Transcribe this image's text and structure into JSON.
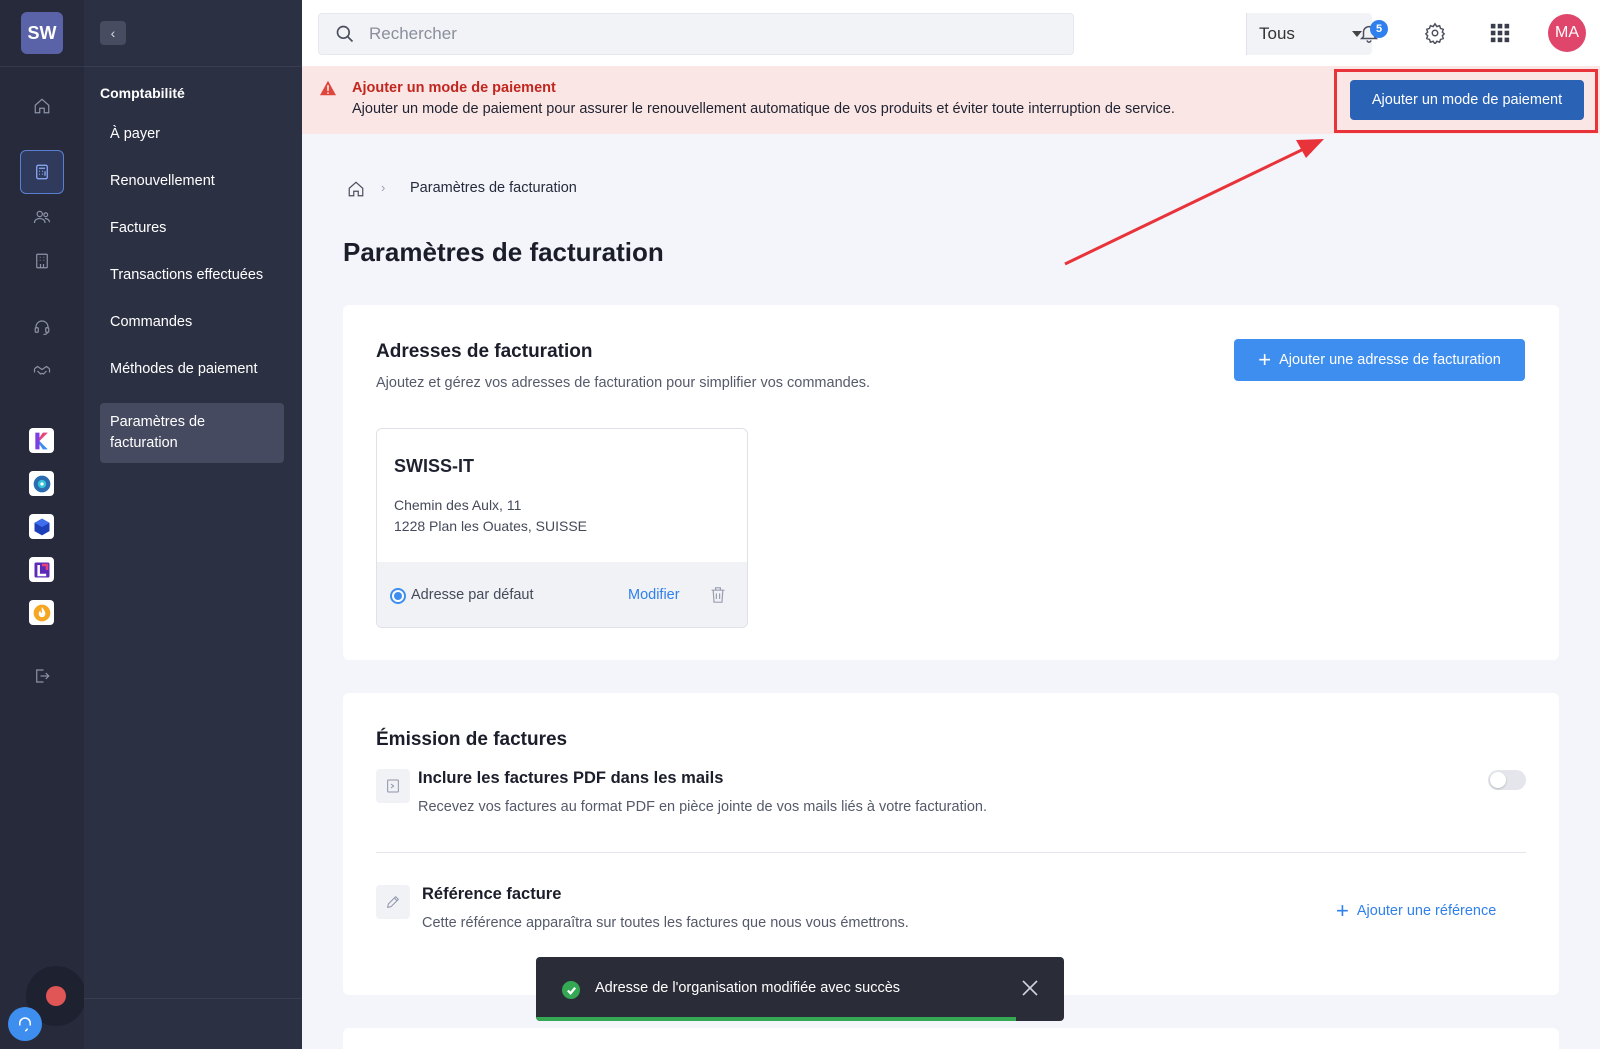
{
  "rail": {
    "logo": "SW",
    "icons": [
      "home-icon",
      "calculator-icon",
      "users-icon",
      "building-icon",
      "headset-icon",
      "handshake-icon"
    ],
    "apps": [
      "app-k-icon",
      "app-circle-icon",
      "app-cube-icon",
      "app-l-icon",
      "app-flame-icon"
    ],
    "logout": "logout-icon"
  },
  "sidebar": {
    "section": "Comptabilité",
    "items": [
      {
        "label": "À payer"
      },
      {
        "label": "Renouvellement"
      },
      {
        "label": "Factures"
      },
      {
        "label": "Transactions effectuées"
      },
      {
        "label": "Commandes"
      },
      {
        "label": "Méthodes de paiement"
      },
      {
        "label": "Paramètres de facturation",
        "active": true
      }
    ]
  },
  "topbar": {
    "search_placeholder": "Rechercher",
    "scope": "Tous",
    "notifications_count": "5",
    "avatar": "MA"
  },
  "alert": {
    "title": "Ajouter un mode de paiement",
    "message": "Ajouter un mode de paiement pour assurer le renouvellement automatique de vos produits et éviter toute interruption de service.",
    "button": "Ajouter un mode de paiement"
  },
  "breadcrumb": {
    "current": "Paramètres de facturation"
  },
  "page": {
    "title": "Paramètres de facturation"
  },
  "billing": {
    "title": "Adresses de facturation",
    "subtitle": "Ajoutez et gérez vos adresses de facturation pour simplifier vos commandes.",
    "add_button": "Ajouter une adresse de facturation",
    "address": {
      "name": "SWISS-IT",
      "line1": "Chemin des Aulx, 11",
      "line2": "1228 Plan les Ouates, SUISSE",
      "default_label": "Adresse par défaut",
      "modify": "Modifier"
    }
  },
  "emission": {
    "title": "Émission de factures",
    "pdf": {
      "title": "Inclure les factures PDF dans les mails",
      "desc": "Recevez vos factures au format PDF en pièce jointe de vos mails liés à votre facturation.",
      "enabled": false
    },
    "reference": {
      "title": "Référence facture",
      "desc": "Cette référence apparaîtra sur toutes les factures que nous vous émettrons.",
      "add": "Ajouter une référence"
    }
  },
  "toast": {
    "message": "Adresse de l'organisation modifiée avec succès",
    "progress_fraction": 0.91
  },
  "colors": {
    "accent": "#3e8ef0",
    "alert_bg": "#fbe6e6",
    "alert_text": "#c2271f",
    "annotation": "#e8333a",
    "success": "#34a853"
  }
}
